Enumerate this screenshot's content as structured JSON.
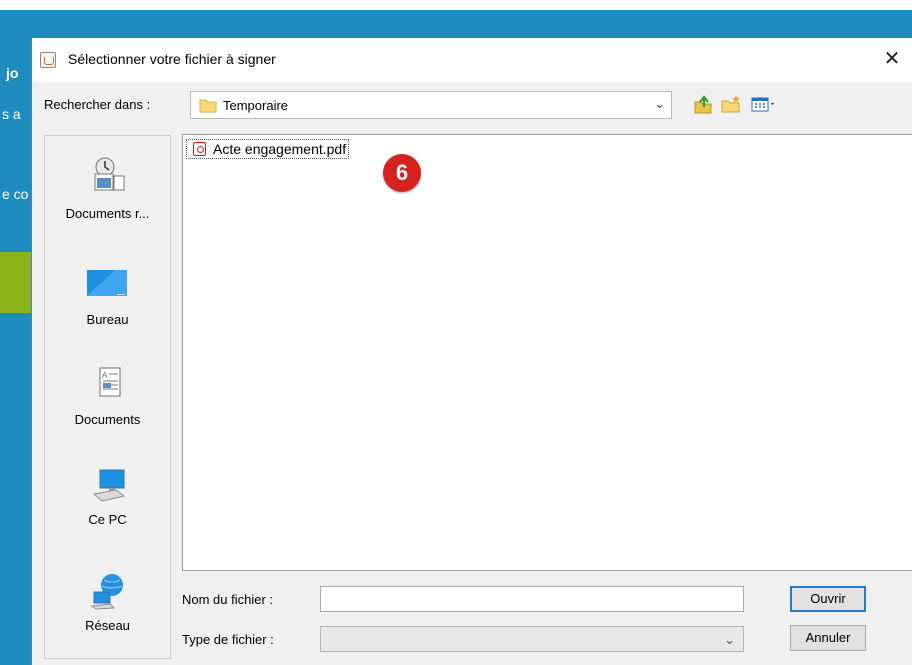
{
  "background": {
    "fragments": [
      "jo",
      "s a",
      "e co"
    ]
  },
  "dialog": {
    "title": "Sélectionner votre fichier à signer",
    "close_label": "✕",
    "look_in_label": "Rechercher dans :",
    "look_in_value": "Temporaire",
    "toolbar_icons": [
      "up-folder-icon",
      "new-folder-icon",
      "view-menu-icon"
    ]
  },
  "places": [
    {
      "label": "Documents r...",
      "icon": "recent-documents-icon"
    },
    {
      "label": "Bureau",
      "icon": "desktop-icon"
    },
    {
      "label": "Documents",
      "icon": "documents-icon"
    },
    {
      "label": "Ce PC",
      "icon": "computer-icon"
    },
    {
      "label": "Réseau",
      "icon": "network-icon"
    }
  ],
  "files": [
    {
      "name": "Acte engagement.pdf",
      "icon": "pdf-file-icon"
    }
  ],
  "annotation": {
    "step": "6",
    "color": "#d4231e"
  },
  "form": {
    "file_name_label": "Nom du fichier :",
    "file_name_value": "",
    "file_type_label": "Type de fichier :",
    "file_type_value": "",
    "open_button": "Ouvrir",
    "cancel_button": "Annuler"
  },
  "colors": {
    "accent": "#1f8cc0",
    "green": "#8cb31c",
    "badge": "#d4231e"
  }
}
